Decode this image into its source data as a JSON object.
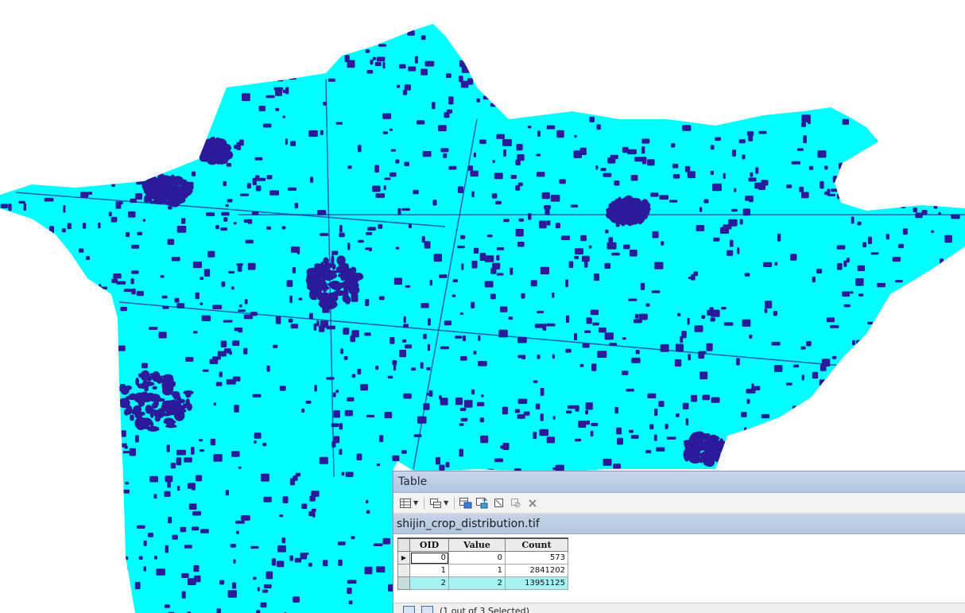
{
  "window": {
    "title": "Table"
  },
  "toolbar": {
    "buttons": [
      {
        "icon": "table-options-icon",
        "has_dropdown": true
      },
      {
        "icon": "related-tables-icon",
        "has_dropdown": true
      },
      {
        "icon": "select-by-attributes-icon"
      },
      {
        "icon": "switch-selection-icon"
      },
      {
        "icon": "clear-selection-icon"
      },
      {
        "icon": "zoom-to-selected-icon"
      },
      {
        "icon": "delete-selected-icon"
      }
    ]
  },
  "tab": {
    "label": "shijin_crop_distribution.tif"
  },
  "table": {
    "columns": [
      "OID",
      "Value",
      "Count"
    ],
    "rows": [
      {
        "OID": "0",
        "Value": "0",
        "Count": "573",
        "active": true,
        "selected": false
      },
      {
        "OID": "1",
        "Value": "1",
        "Count": "2841202",
        "active": false,
        "selected": false
      },
      {
        "OID": "2",
        "Value": "2",
        "Count": "13951125",
        "active": false,
        "selected": true
      }
    ]
  },
  "status": {
    "text": "(1 out of 3 Selected)"
  },
  "colors": {
    "map_fill": "#00ffff",
    "map_dots": "#2b1a9a",
    "selected_row": "#a5f2f2",
    "title_bar": "#c9d6e8"
  }
}
